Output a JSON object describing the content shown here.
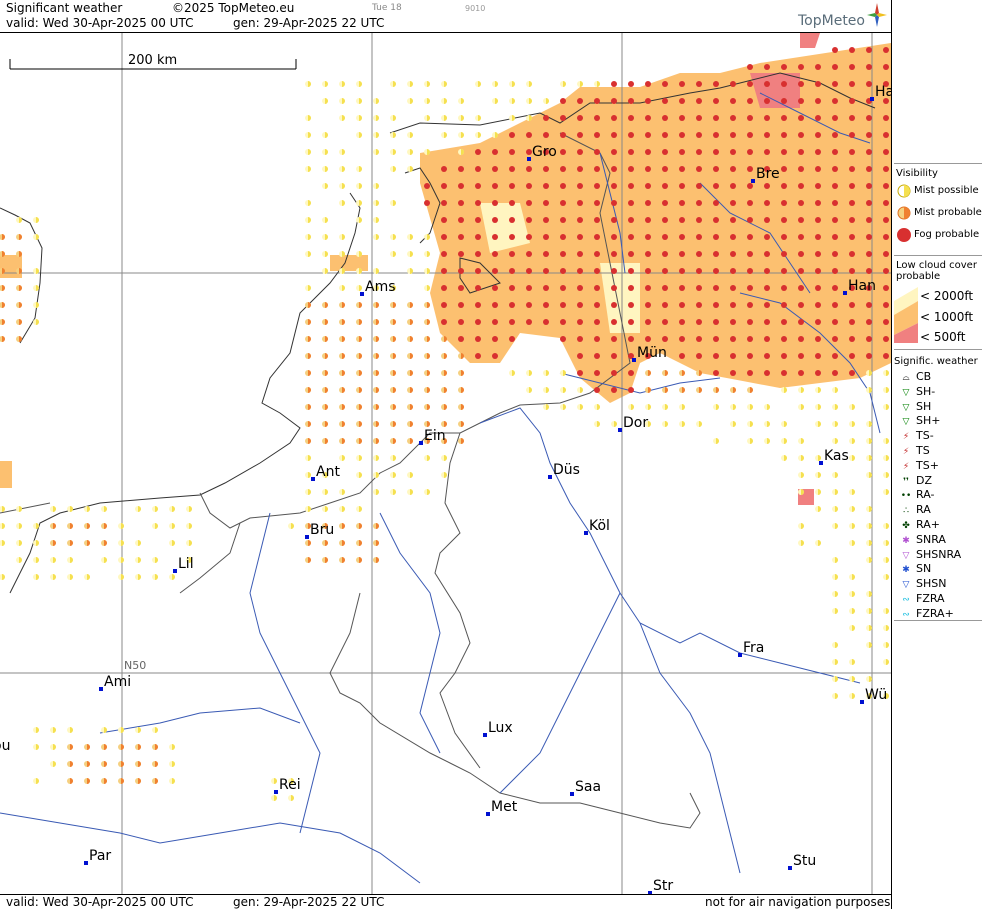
{
  "header": {
    "title": "Significant weather",
    "copyright": "©2025 TopMeteo.eu",
    "valid": "valid:  Wed  30-Apr-2025  00 UTC",
    "gen": "gen: 29-Apr-2025 22 UTC",
    "small1": "Tue 18",
    "small2": "9010",
    "brand": "TopMeteo"
  },
  "footer": {
    "valid": "valid:  Wed  30-Apr-2025  00 UTC",
    "gen": "gen: 29-Apr-2025 22 UTC",
    "note": "not for air navigation purposes"
  },
  "map": {
    "scale_label": "200 km",
    "lat_label": "N50",
    "cities": [
      {
        "name": "Ha"
      },
      {
        "name": "Gro"
      },
      {
        "name": "Bre"
      },
      {
        "name": "Ams"
      },
      {
        "name": "Han"
      },
      {
        "name": "Mün"
      },
      {
        "name": "Dor"
      },
      {
        "name": "Ein"
      },
      {
        "name": "Ant"
      },
      {
        "name": "Düs"
      },
      {
        "name": "Kas"
      },
      {
        "name": "Bru"
      },
      {
        "name": "Köl"
      },
      {
        "name": "Lil"
      },
      {
        "name": "Fra"
      },
      {
        "name": "Ami"
      },
      {
        "name": "Wü"
      },
      {
        "name": "Lux"
      },
      {
        "name": "ou"
      },
      {
        "name": "Rei"
      },
      {
        "name": "Saa"
      },
      {
        "name": "Met"
      },
      {
        "name": "Stu"
      },
      {
        "name": "Par"
      },
      {
        "name": "Str"
      }
    ]
  },
  "legend": {
    "visibility_title": "Visibility",
    "mist_possible": "Mist possible",
    "mist_probable": "Mist probable",
    "fog_probable": "Fog probable",
    "lowcloud_title_1": "Low cloud cover",
    "lowcloud_title_2": "probable",
    "lc_2000": "< 2000ft",
    "lc_1000": "< 1000ft",
    "lc_500": "<   500ft",
    "signif_title": "Signific. weather",
    "wx": [
      "CB",
      "SH-",
      "SH",
      "SH+",
      "TS-",
      "TS",
      "TS+",
      "DZ",
      "RA-",
      "RA",
      "RA+",
      "SNRA",
      "SHSNRA",
      "SN",
      "SHSN",
      "FZRA",
      "FZRA+"
    ],
    "colors": {
      "mist_possible": "#f5e050",
      "mist_probable": "#f08030",
      "fog": "#d83030",
      "lc_2000": "#fff5c0",
      "lc_1000": "#fcc070",
      "lc_500": "#f08080"
    }
  }
}
